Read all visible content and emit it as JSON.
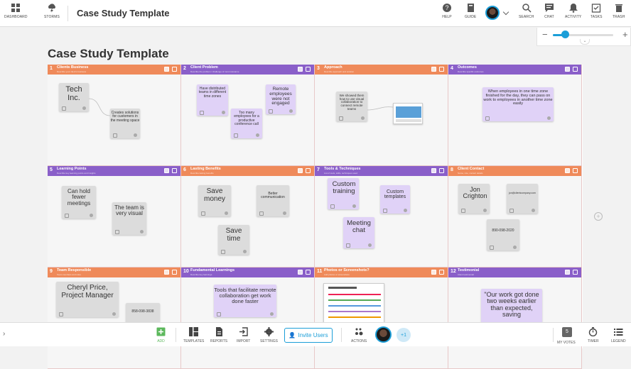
{
  "header": {
    "dashboard_label": "DASHBOARD",
    "storms_label": "STORMS",
    "title": "Case Study Template",
    "help_label": "HELP",
    "guide_label": "GUIDE",
    "search_label": "SEARCH",
    "chat_label": "CHAT",
    "activity_label": "ACTIVITY",
    "tasks_label": "TASKS",
    "trash_label": "TRASH"
  },
  "zoom": {
    "minus": "−",
    "plus": "+",
    "level": 0.2
  },
  "board": {
    "title": "Case Study Template",
    "panels": [
      {
        "num": "1",
        "title": "Clients Business",
        "subtitle": "Describe your client's business",
        "color": "orange"
      },
      {
        "num": "2",
        "title": "Client Problem",
        "subtitle": "Describe the problem / challenge of most relevance",
        "color": "purple"
      },
      {
        "num": "3",
        "title": "Approach",
        "subtitle": "Describe approach and solution",
        "color": "orange"
      },
      {
        "num": "4",
        "title": "Outcomes",
        "subtitle": "Describe specific outcomes",
        "color": "purple"
      },
      {
        "num": "5",
        "title": "Learning Points",
        "subtitle": "Describe key learning points and insights",
        "color": "purple"
      },
      {
        "num": "6",
        "title": "Lasting Benefits",
        "subtitle": "Describe lasting benefits",
        "color": "orange"
      },
      {
        "num": "7",
        "title": "Tools & Techniques",
        "subtitle": "List of tools, skills, techniques used",
        "color": "purple"
      },
      {
        "num": "8",
        "title": "Client Contact",
        "subtitle": "Name, role, contact details",
        "color": "orange"
      },
      {
        "num": "9",
        "title": "Team Responsible",
        "subtitle": "Team members and roles",
        "color": "orange"
      },
      {
        "num": "10",
        "title": "Fundamental Learnings",
        "subtitle": "Describe key learnings",
        "color": "purple"
      },
      {
        "num": "11",
        "title": "Photos or Screenshots?",
        "subtitle": "Add photos or screenshots",
        "color": "orange"
      },
      {
        "num": "12",
        "title": "Testimonial",
        "subtitle": "Client testimonial",
        "color": "purple"
      }
    ],
    "notes": {
      "p1_a": "Tech Inc.",
      "p1_b": "Creates solutions for customers in the meeting space",
      "p2_a": "Have distributed teams in different time zones",
      "p2_b": "Remote employees were not engaged",
      "p2_c": "Too many employees for a productive conference call",
      "p3_a": "We showed them how to use visual collaboration to connect remote teams",
      "p4_a": "When employees in one time zone finished for the day, they can pass on work to employees in another time zone easily",
      "p5_a": "Can hold fewer meetings",
      "p5_b": "The team is very visual",
      "p6_a": "Save money",
      "p6_b": "Better communication",
      "p6_c": "Save time",
      "p7_a": "Custom training",
      "p7_b": "Custom templates",
      "p7_c": "Meeting chat",
      "p8_a": "Jon Crighton",
      "p8_b": "jon@clientcompany.com",
      "p8_c": "890-098-2020",
      "p9_a": "Cheryl Price, Project Manager",
      "p9_b": "858-098-3838",
      "p10_a": "Tools that facilitate remote collaboration get work done faster",
      "p12_a": "\"Our work got done two weeks earlier than expected, saving"
    }
  },
  "footer": {
    "add_label": "ADD",
    "templates_label": "TEMPLATES",
    "reports_label": "REPORTS",
    "import_label": "IMPORT",
    "settings_label": "SETTINGS",
    "invite_label": "Invite Users",
    "actions_label": "ACTIONS",
    "plus_count": "+1",
    "votes_count": "5",
    "my_votes_label": "MY VOTES",
    "timer_label": "TIMER",
    "legend_label": "LEGEND",
    "expand_glyph": "›"
  },
  "colors": {
    "accent": "#1b9ed8",
    "orange": "#ef8a5a",
    "purple": "#8a5fc9",
    "add_green": "#5cb85c"
  }
}
